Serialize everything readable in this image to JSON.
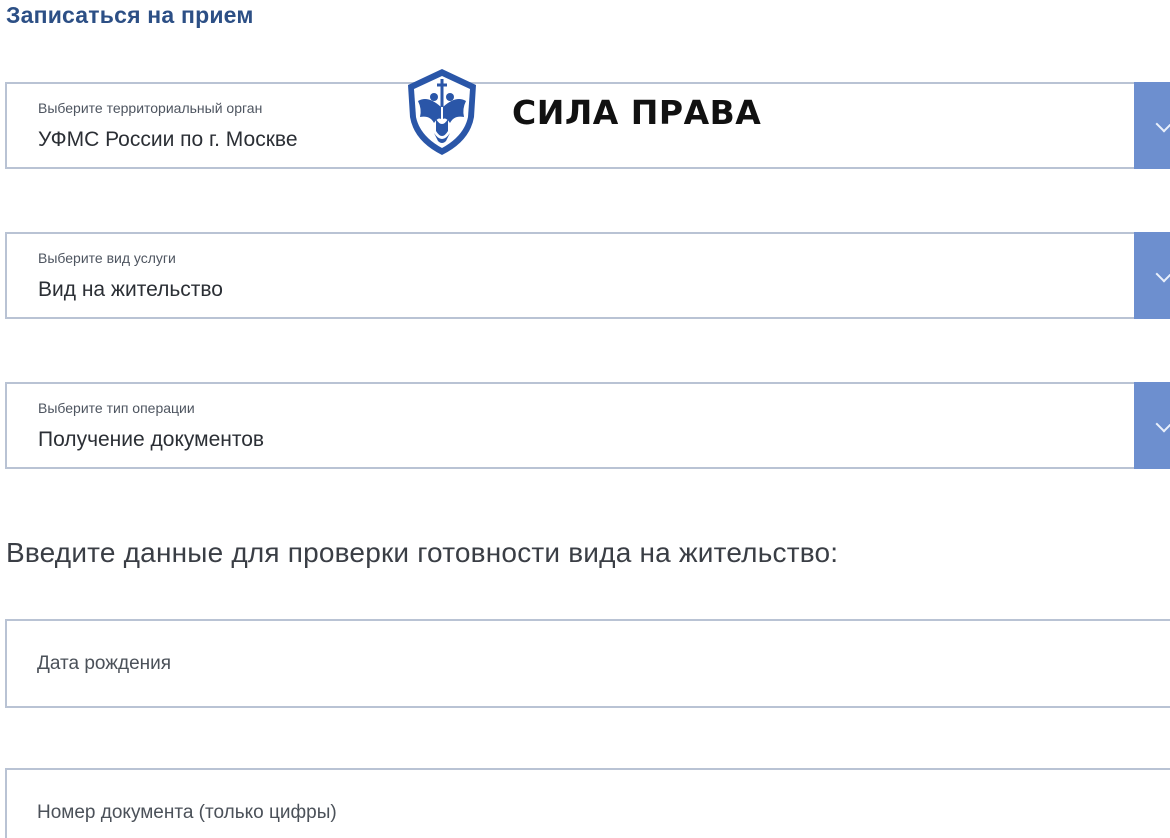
{
  "page": {
    "title": "Записаться на прием"
  },
  "selects": {
    "org": {
      "label": "Выберите территориальный орган",
      "value": "УФМС России по г. Москве"
    },
    "service": {
      "label": "Выберите вид услуги",
      "value": "Вид на жительство"
    },
    "operation": {
      "label": "Выберите тип операции",
      "value": "Получение документов"
    }
  },
  "check_form": {
    "heading": "Введите данные для проверки готовности вида на жительство:",
    "birthdate_placeholder": "Дата рождения",
    "docnum_placeholder": "Номер документа (только цифры)"
  },
  "watermark": {
    "brand": "СИЛА ПРАВА",
    "icon": "eagle-shield-icon"
  },
  "colors": {
    "title": "#2c4f85",
    "dropdown_button": "#6d8fcf",
    "field_border": "#b9c3d4",
    "brand_shield": "#2a56a8"
  }
}
